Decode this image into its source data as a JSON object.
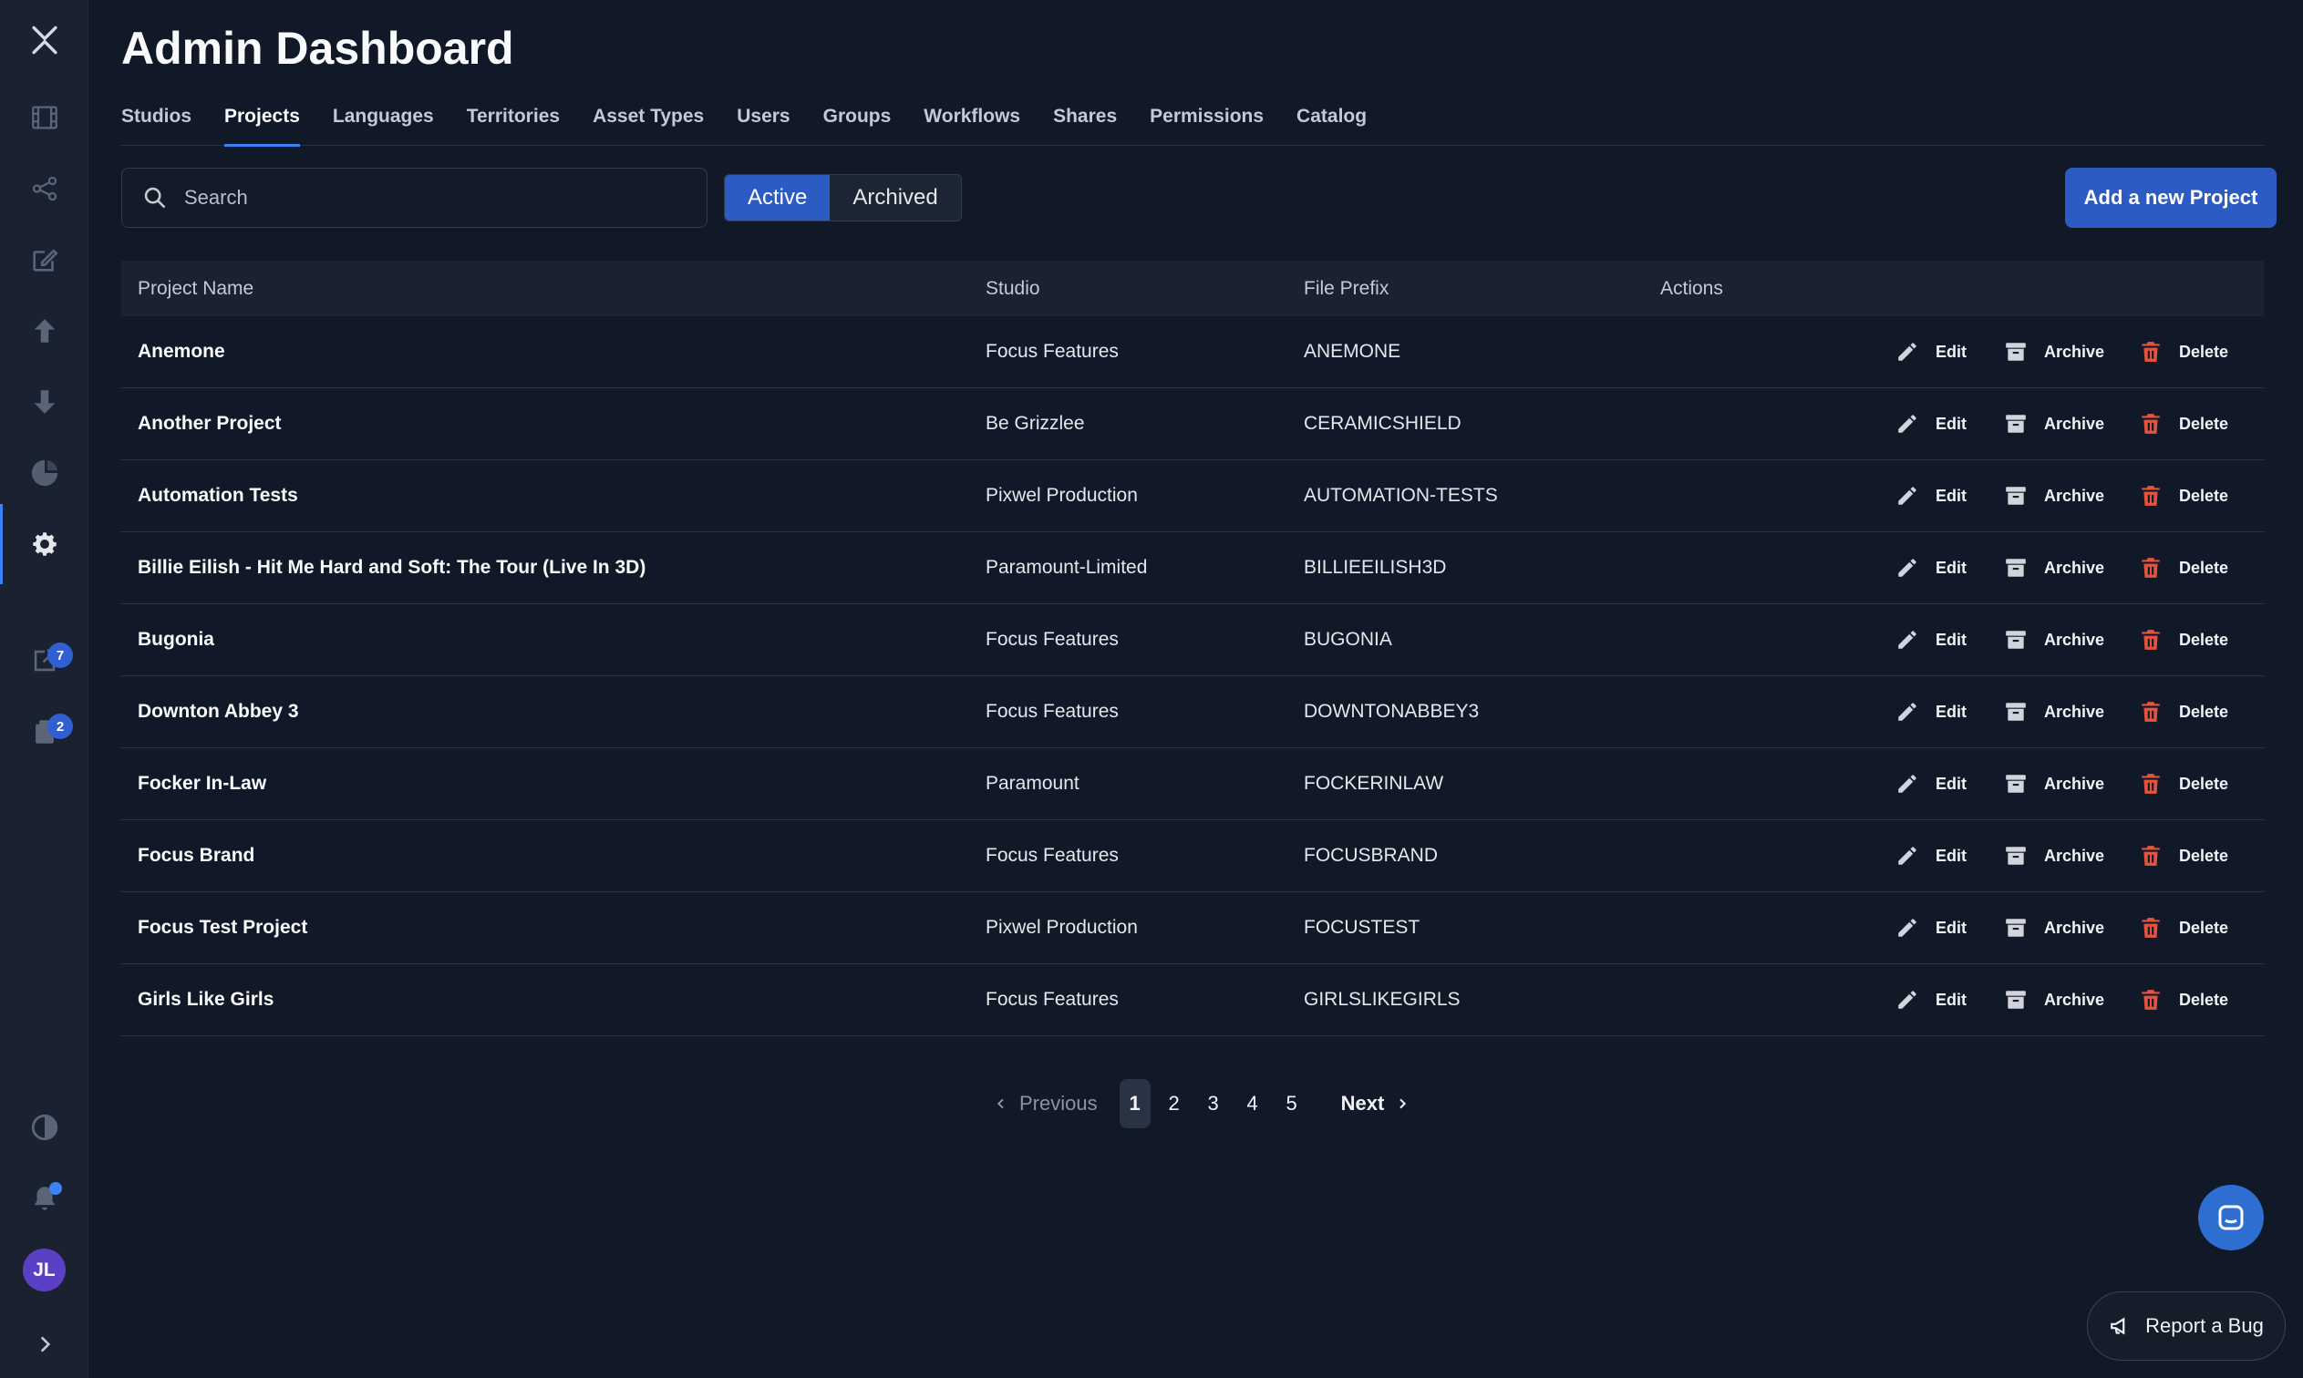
{
  "sidebar": {
    "logo": "x-logo-icon",
    "items": [
      {
        "icon": "film-icon",
        "active": false
      },
      {
        "icon": "share-icon",
        "active": false
      },
      {
        "icon": "edit-clipboard-icon",
        "active": false
      },
      {
        "icon": "upload-arrow-icon",
        "active": false
      },
      {
        "icon": "download-arrow-icon",
        "active": false
      },
      {
        "icon": "pie-chart-icon",
        "active": false
      },
      {
        "icon": "gear-icon",
        "active": true
      },
      {
        "icon": "external-link-icon",
        "badge": "7"
      },
      {
        "icon": "clipboard-icon",
        "badge": "2"
      }
    ],
    "bottom": {
      "theme_icon": "contrast-icon",
      "notification_icon": "bell-icon",
      "avatar_initials": "JL",
      "expand_icon": "chevron-right-icon"
    }
  },
  "header": {
    "title": "Admin Dashboard",
    "tabs": [
      "Studios",
      "Projects",
      "Languages",
      "Territories",
      "Asset Types",
      "Users",
      "Groups",
      "Workflows",
      "Shares",
      "Permissions",
      "Catalog"
    ],
    "active_tab": "Projects"
  },
  "toolbar": {
    "search_placeholder": "Search",
    "filter_active": "Active",
    "filter_archived": "Archived",
    "add_button": "Add a new Project"
  },
  "table": {
    "columns": {
      "name": "Project Name",
      "studio": "Studio",
      "prefix": "File Prefix",
      "actions": "Actions"
    },
    "action_labels": {
      "edit": "Edit",
      "archive": "Archive",
      "delete": "Delete"
    },
    "rows": [
      {
        "name": "Anemone",
        "studio": "Focus Features",
        "prefix": "ANEMONE"
      },
      {
        "name": "Another Project",
        "studio": "Be Grizzlee",
        "prefix": "CERAMICSHIELD"
      },
      {
        "name": "Automation Tests",
        "studio": "Pixwel Production",
        "prefix": "AUTOMATION-TESTS"
      },
      {
        "name": "Billie Eilish - Hit Me Hard and Soft: The Tour (Live In 3D)",
        "studio": "Paramount-Limited",
        "prefix": "BILLIEEILISH3D"
      },
      {
        "name": "Bugonia",
        "studio": "Focus Features",
        "prefix": "BUGONIA"
      },
      {
        "name": "Downton Abbey 3",
        "studio": "Focus Features",
        "prefix": "DOWNTONABBEY3"
      },
      {
        "name": "Focker In-Law",
        "studio": "Paramount",
        "prefix": "FOCKERINLAW"
      },
      {
        "name": "Focus Brand",
        "studio": "Focus Features",
        "prefix": "FOCUSBRAND"
      },
      {
        "name": "Focus Test Project",
        "studio": "Pixwel Production",
        "prefix": "FOCUSTEST"
      },
      {
        "name": "Girls Like Girls",
        "studio": "Focus Features",
        "prefix": "GIRLSLIKEGIRLS"
      }
    ]
  },
  "pagination": {
    "previous": "Previous",
    "next": "Next",
    "pages": [
      "1",
      "2",
      "3",
      "4",
      "5"
    ],
    "current": "1"
  },
  "floating": {
    "chat_icon": "chat-bubble-icon",
    "report_bug": "Report a Bug"
  },
  "colors": {
    "background": "#111827",
    "sidebar": "#1a2232",
    "accent": "#2d5bc4",
    "delete": "#e5533d"
  }
}
